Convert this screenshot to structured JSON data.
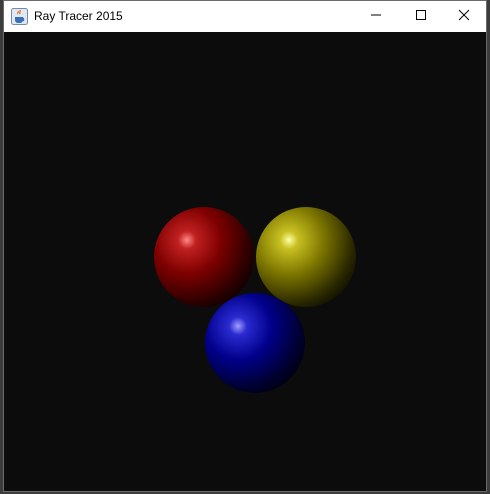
{
  "window": {
    "title": "Ray Tracer 2015",
    "app_icon": "java-cup-icon",
    "controls": {
      "minimize": "minimize-icon",
      "maximize": "maximize-icon",
      "close": "close-icon"
    }
  },
  "scene": {
    "background": "#0c0c0c",
    "spheres": [
      {
        "name": "red-sphere",
        "color": "#8a0000",
        "highlight": "#ff7a7a"
      },
      {
        "name": "yellow-sphere",
        "color": "#8f8a00",
        "highlight": "#ffff9a"
      },
      {
        "name": "blue-sphere",
        "color": "#00008c",
        "highlight": "#8a8aff"
      }
    ]
  }
}
